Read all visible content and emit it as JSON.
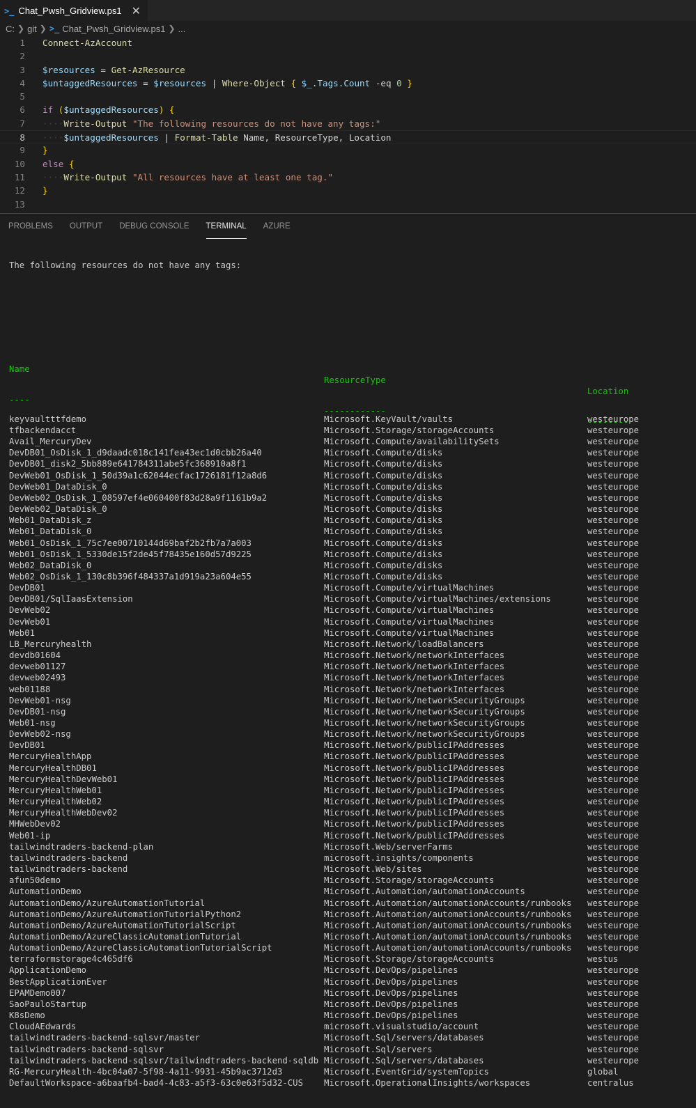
{
  "tab": {
    "title": "Chat_Pwsh_Gridview.ps1",
    "close": "✕",
    "icon": ">_"
  },
  "breadcrumb": {
    "drive": "C:",
    "folder": "git",
    "file": "Chat_Pwsh_Gridview.ps1",
    "more": "..."
  },
  "editor": {
    "active_line": 8,
    "line_numbers": [
      "1",
      "2",
      "3",
      "4",
      "5",
      "6",
      "7",
      "8",
      "9",
      "10",
      "11",
      "12",
      "13"
    ],
    "tokens": {
      "connect": "Connect-AzAccount",
      "resources_var": "$resources",
      "eq": "=",
      "get_azresource": "Get-AzResource",
      "untagged_var": "$untaggedResources",
      "pipe": "|",
      "where_object": "Where-Object",
      "tags_count": "$_.Tags.Count",
      "eq_op": "-eq",
      "zero": "0",
      "if_kw": "if",
      "write_output": "Write-Output",
      "msg_following": "\"The following resources do not have any tags:\"",
      "format_table": "Format-Table",
      "format_args": "Name, ResourceType, Location",
      "else_kw": "else",
      "msg_all": "\"All resources have at least one tag.\""
    }
  },
  "panel": {
    "tabs": [
      "PROBLEMS",
      "OUTPUT",
      "DEBUG CONSOLE",
      "TERMINAL",
      "AZURE"
    ],
    "active_tab": "TERMINAL"
  },
  "terminal": {
    "intro": "The following resources do not have any tags:",
    "headers": [
      "Name",
      "ResourceType",
      "Location"
    ],
    "underlines": [
      "----",
      "------------",
      "--------"
    ],
    "rows": [
      [
        "keyvaultttfdemo",
        "Microsoft.KeyVault/vaults",
        "westeurope"
      ],
      [
        "tfbackendacct",
        "Microsoft.Storage/storageAccounts",
        "westeurope"
      ],
      [
        "Avail_MercuryDev",
        "Microsoft.Compute/availabilitySets",
        "westeurope"
      ],
      [
        "DevDB01_OsDisk_1_d9daadc018c141fea43ec1d0cbb26a40",
        "Microsoft.Compute/disks",
        "westeurope"
      ],
      [
        "DevDB01_disk2_5bb889e641784311abe5fc368910a8f1",
        "Microsoft.Compute/disks",
        "westeurope"
      ],
      [
        "DevWeb01_OsDisk_1_50d39a1c62044ecfac1726181f12a8d6",
        "Microsoft.Compute/disks",
        "westeurope"
      ],
      [
        "DevWeb01_DataDisk_0",
        "Microsoft.Compute/disks",
        "westeurope"
      ],
      [
        "DevWeb02_OsDisk_1_08597ef4e060400f83d28a9f1161b9a2",
        "Microsoft.Compute/disks",
        "westeurope"
      ],
      [
        "DevWeb02_DataDisk_0",
        "Microsoft.Compute/disks",
        "westeurope"
      ],
      [
        "Web01_DataDisk_z",
        "Microsoft.Compute/disks",
        "westeurope"
      ],
      [
        "Web01_DataDisk_0",
        "Microsoft.Compute/disks",
        "westeurope"
      ],
      [
        "Web01_OsDisk_1_75c7ee00710144d69baf2b2fb7a7a003",
        "Microsoft.Compute/disks",
        "westeurope"
      ],
      [
        "Web01_OsDisk_1_5330de15f2de45f78435e160d57d9225",
        "Microsoft.Compute/disks",
        "westeurope"
      ],
      [
        "Web02_DataDisk_0",
        "Microsoft.Compute/disks",
        "westeurope"
      ],
      [
        "Web02_OsDisk_1_130c8b396f484337a1d919a23a604e55",
        "Microsoft.Compute/disks",
        "westeurope"
      ],
      [
        "DevDB01",
        "Microsoft.Compute/virtualMachines",
        "westeurope"
      ],
      [
        "DevDB01/SqlIaasExtension",
        "Microsoft.Compute/virtualMachines/extensions",
        "westeurope"
      ],
      [
        "DevWeb02",
        "Microsoft.Compute/virtualMachines",
        "westeurope"
      ],
      [
        "DevWeb01",
        "Microsoft.Compute/virtualMachines",
        "westeurope"
      ],
      [
        "Web01",
        "Microsoft.Compute/virtualMachines",
        "westeurope"
      ],
      [
        "LB_Mercuryhealth",
        "Microsoft.Network/loadBalancers",
        "westeurope"
      ],
      [
        "devdb01604",
        "Microsoft.Network/networkInterfaces",
        "westeurope"
      ],
      [
        "devweb01127",
        "Microsoft.Network/networkInterfaces",
        "westeurope"
      ],
      [
        "devweb02493",
        "Microsoft.Network/networkInterfaces",
        "westeurope"
      ],
      [
        "web01188",
        "Microsoft.Network/networkInterfaces",
        "westeurope"
      ],
      [
        "DevWeb01-nsg",
        "Microsoft.Network/networkSecurityGroups",
        "westeurope"
      ],
      [
        "DevDB01-nsg",
        "Microsoft.Network/networkSecurityGroups",
        "westeurope"
      ],
      [
        "Web01-nsg",
        "Microsoft.Network/networkSecurityGroups",
        "westeurope"
      ],
      [
        "DevWeb02-nsg",
        "Microsoft.Network/networkSecurityGroups",
        "westeurope"
      ],
      [
        "DevDB01",
        "Microsoft.Network/publicIPAddresses",
        "westeurope"
      ],
      [
        "MercuryHealthApp",
        "Microsoft.Network/publicIPAddresses",
        "westeurope"
      ],
      [
        "MercuryHealthDB01",
        "Microsoft.Network/publicIPAddresses",
        "westeurope"
      ],
      [
        "MercuryHealthDevWeb01",
        "Microsoft.Network/publicIPAddresses",
        "westeurope"
      ],
      [
        "MercuryHealthWeb01",
        "Microsoft.Network/publicIPAddresses",
        "westeurope"
      ],
      [
        "MercuryHealthWeb02",
        "Microsoft.Network/publicIPAddresses",
        "westeurope"
      ],
      [
        "MercuryHealthWebDev02",
        "Microsoft.Network/publicIPAddresses",
        "westeurope"
      ],
      [
        "MHWebDev02",
        "Microsoft.Network/publicIPAddresses",
        "westeurope"
      ],
      [
        "Web01-ip",
        "Microsoft.Network/publicIPAddresses",
        "westeurope"
      ],
      [
        "tailwindtraders-backend-plan",
        "Microsoft.Web/serverFarms",
        "westeurope"
      ],
      [
        "tailwindtraders-backend",
        "microsoft.insights/components",
        "westeurope"
      ],
      [
        "tailwindtraders-backend",
        "Microsoft.Web/sites",
        "westeurope"
      ],
      [
        "afun50demo",
        "Microsoft.Storage/storageAccounts",
        "westeurope"
      ],
      [
        "AutomationDemo",
        "Microsoft.Automation/automationAccounts",
        "westeurope"
      ],
      [
        "AutomationDemo/AzureAutomationTutorial",
        "Microsoft.Automation/automationAccounts/runbooks",
        "westeurope"
      ],
      [
        "AutomationDemo/AzureAutomationTutorialPython2",
        "Microsoft.Automation/automationAccounts/runbooks",
        "westeurope"
      ],
      [
        "AutomationDemo/AzureAutomationTutorialScript",
        "Microsoft.Automation/automationAccounts/runbooks",
        "westeurope"
      ],
      [
        "AutomationDemo/AzureClassicAutomationTutorial",
        "Microsoft.Automation/automationAccounts/runbooks",
        "westeurope"
      ],
      [
        "AutomationDemo/AzureClassicAutomationTutorialScript",
        "Microsoft.Automation/automationAccounts/runbooks",
        "westeurope"
      ],
      [
        "terraformstorage4c465df6",
        "Microsoft.Storage/storageAccounts",
        "westus"
      ],
      [
        "ApplicationDemo",
        "Microsoft.DevOps/pipelines",
        "westeurope"
      ],
      [
        "BestApplicationEver",
        "Microsoft.DevOps/pipelines",
        "westeurope"
      ],
      [
        "EPAMDemo007",
        "Microsoft.DevOps/pipelines",
        "westeurope"
      ],
      [
        "SaoPauloStartup",
        "Microsoft.DevOps/pipelines",
        "westeurope"
      ],
      [
        "K8sDemo",
        "Microsoft.DevOps/pipelines",
        "westeurope"
      ],
      [
        "CloudAEdwards",
        "microsoft.visualstudio/account",
        "westeurope"
      ],
      [
        "tailwindtraders-backend-sqlsvr/master",
        "Microsoft.Sql/servers/databases",
        "westeurope"
      ],
      [
        "tailwindtraders-backend-sqlsvr",
        "Microsoft.Sql/servers",
        "westeurope"
      ],
      [
        "tailwindtraders-backend-sqlsvr/tailwindtraders-backend-sqldb",
        "Microsoft.Sql/servers/databases",
        "westeurope"
      ],
      [
        "RG-MercuryHealth-4bc04a07-5f98-4a11-9931-45b9ac3712d3",
        "Microsoft.EventGrid/systemTopics",
        "global"
      ],
      [
        "DefaultWorkspace-a6baafb4-bad4-4c83-a5f3-63c0e63f5d32-CUS",
        "Microsoft.OperationalInsights/workspaces",
        "centralus"
      ]
    ]
  }
}
